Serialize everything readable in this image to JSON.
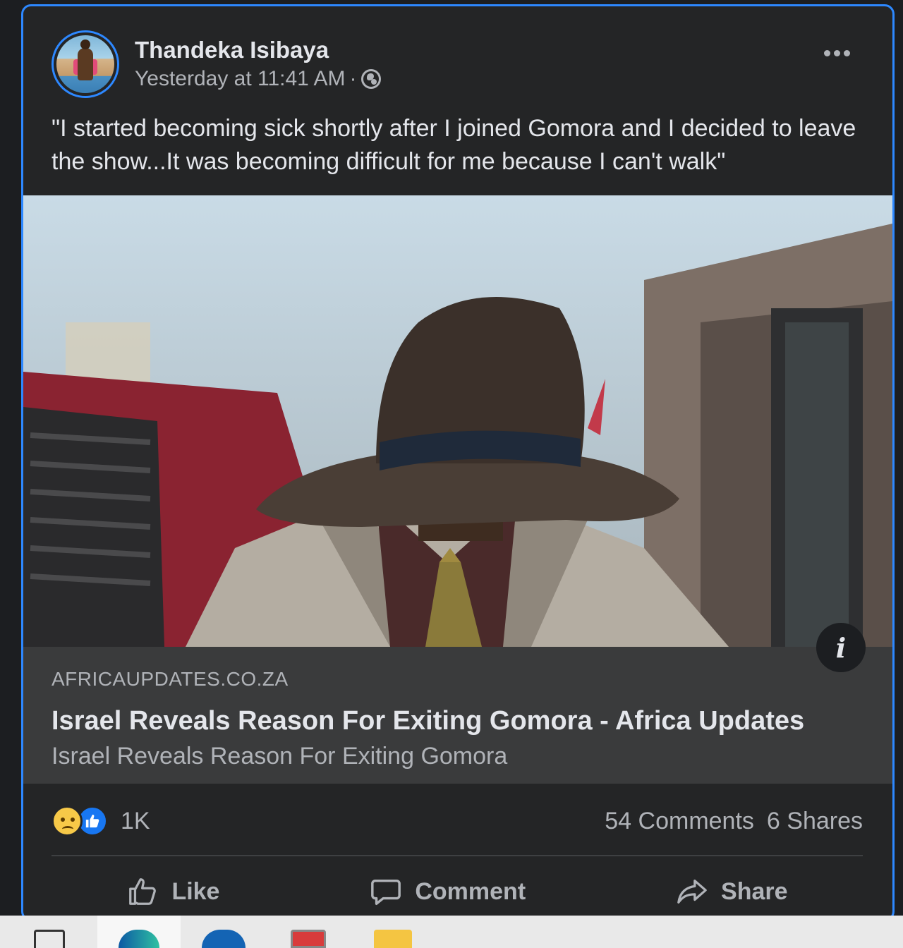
{
  "post": {
    "author": "Thandeka Isibaya",
    "timestamp": "Yesterday at 11:41 AM",
    "separator": "·",
    "audience_icon": "globe-icon",
    "caption": "\"I started becoming sick shortly after I joined Gomora and I decided to leave the show...It was becoming difficult for me because I can't walk\""
  },
  "link": {
    "domain": "AFRICAUPDATES.CO.ZA",
    "title": "Israel Reveals Reason For Exiting Gomora - Africa Updates",
    "description": "Israel Reveals Reason For Exiting Gomora",
    "info_label": "i"
  },
  "stats": {
    "reaction_icons": [
      "sad-icon",
      "like-icon"
    ],
    "reaction_count": "1K",
    "comments": "54 Comments",
    "shares": "6 Shares"
  },
  "actions": {
    "like": "Like",
    "comment": "Comment",
    "share": "Share"
  },
  "colors": {
    "accent": "#2d88ff",
    "background": "#242526",
    "text": "#e4e6eb",
    "secondary_text": "#b0b3b8"
  }
}
